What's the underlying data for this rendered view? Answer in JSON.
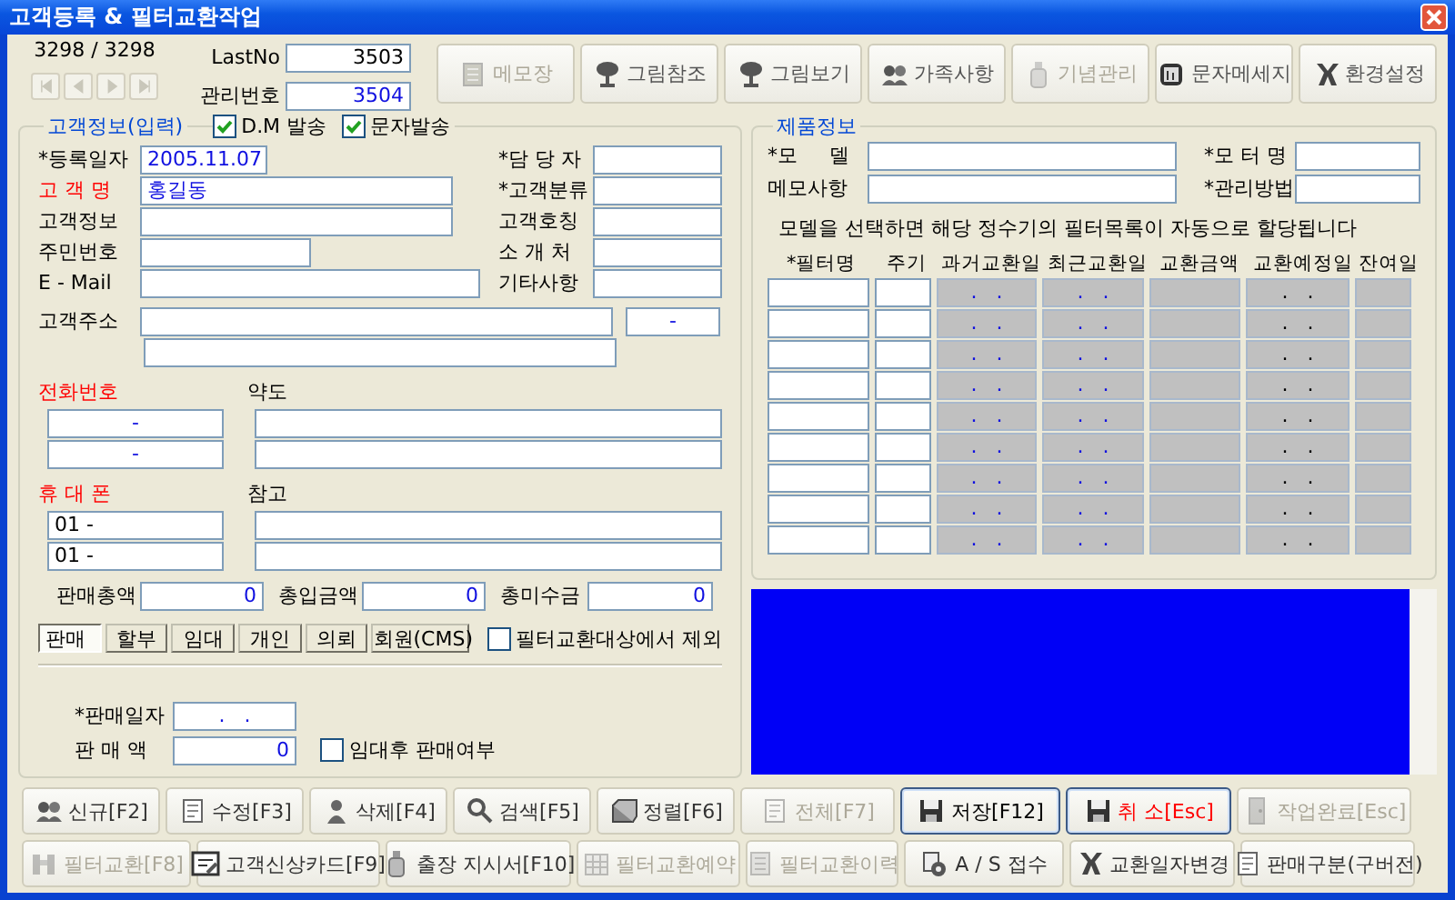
{
  "window": {
    "title": "고객등록 & 필터교환작업"
  },
  "record_nav": {
    "counter": "3298 / 3298",
    "buttons": [
      {
        "kind": "first",
        "disabled": true
      },
      {
        "kind": "prev",
        "disabled": true
      },
      {
        "kind": "next",
        "disabled": true
      },
      {
        "kind": "last",
        "disabled": true
      }
    ]
  },
  "last_no": {
    "label": "LastNo",
    "value": "3503"
  },
  "manage_no": {
    "label": "관리번호",
    "value": "3504"
  },
  "toolbar": [
    {
      "label": "메모장",
      "disabled": true
    },
    {
      "label": "그림참조",
      "disabled": false
    },
    {
      "label": "그림보기",
      "disabled": false
    },
    {
      "label": "가족사항",
      "disabled": false
    },
    {
      "label": "기념관리",
      "disabled": true
    },
    {
      "label": "문자메세지",
      "disabled": false
    },
    {
      "label": "환경설정",
      "disabled": false
    }
  ],
  "customer": {
    "title": "고객정보(입력)",
    "options": [
      {
        "label": "D.M 발송",
        "checked": true
      },
      {
        "label": "문자발송",
        "checked": true
      }
    ],
    "rows": [
      {
        "left": {
          "label": "*등록일자",
          "emphasis": false,
          "value": "2005.11.07"
        },
        "right": {
          "label": "*담 당 자",
          "emphasis": false
        }
      },
      {
        "left": {
          "label": "고 객 명",
          "emphasis": true,
          "value": "홍길동"
        },
        "right": {
          "label": "*고객분류",
          "emphasis": false
        }
      },
      {
        "left": {
          "label": "고객정보",
          "emphasis": false
        },
        "right": {
          "label": "고객호칭",
          "emphasis": false
        }
      },
      {
        "left": {
          "label": "주민번호",
          "emphasis": false
        },
        "right": {
          "label": "소 개 처",
          "emphasis": false
        }
      },
      {
        "left": {
          "label": "E - Mail",
          "emphasis": false
        },
        "right": {
          "label": "기타사항",
          "emphasis": false
        }
      }
    ],
    "address": {
      "label": "고객주소",
      "zip": "-"
    },
    "phones": {
      "label": "전화번호",
      "emphasis": true,
      "values": [
        "-",
        "-"
      ]
    },
    "directions": {
      "label": "약도"
    },
    "mobiles": {
      "label": "휴 대 폰",
      "emphasis": true,
      "values": [
        "01 -",
        "01 -"
      ]
    },
    "notes": {
      "label": "참고"
    },
    "totals": [
      {
        "label": "판매총액",
        "value": "0"
      },
      {
        "label": "총입금액",
        "value": "0"
      },
      {
        "label": "총미수금",
        "value": "0"
      }
    ],
    "sale_tabs": [
      {
        "label": "판매",
        "selected": true
      },
      {
        "label": "할부",
        "selected": false
      },
      {
        "label": "임대",
        "selected": false
      },
      {
        "label": "개인",
        "selected": false
      },
      {
        "label": "의뢰",
        "selected": false
      },
      {
        "label": "회원(CMS)",
        "selected": false
      }
    ],
    "exclude_filter": {
      "label": "필터교환대상에서 제외",
      "checked": false
    },
    "sale": {
      "date_label": "*판매일자",
      "date_value": ".   .",
      "amount_label": "판 매 액",
      "amount_value": "0",
      "after_lease": {
        "label": "임대후 판매여부",
        "checked": false
      }
    }
  },
  "product": {
    "title": "제품정보",
    "rows": [
      {
        "left": {
          "label": "*모     델"
        },
        "right": {
          "label": "*모 터 명"
        }
      },
      {
        "left": {
          "label": "메모사항"
        },
        "right": {
          "label": "*관리방법"
        }
      }
    ],
    "hint": "모델을 선택하면 해당 정수기의 필터목록이 자동으로 할당됩니다",
    "filter_table": {
      "columns": [
        "*필터명",
        "주기",
        "과거교환일",
        "최근교환일",
        "교환금액",
        "교환예정일",
        "잔여일"
      ],
      "rows": [
        {
          "past": ".   .",
          "recent": ".   .",
          "planned": ".   ."
        },
        {
          "past": ".   .",
          "recent": ".   .",
          "planned": ".   ."
        },
        {
          "past": ".   .",
          "recent": ".   .",
          "planned": ".   ."
        },
        {
          "past": ".   .",
          "recent": ".   .",
          "planned": ".   ."
        },
        {
          "past": ".   .",
          "recent": ".   .",
          "planned": ".   ."
        },
        {
          "past": ".   .",
          "recent": ".   .",
          "planned": ".   ."
        },
        {
          "past": ".   .",
          "recent": ".   .",
          "planned": ".   ."
        },
        {
          "past": ".   .",
          "recent": ".   .",
          "planned": ".   ."
        },
        {
          "past": ".   .",
          "recent": ".   .",
          "planned": ".   ."
        }
      ]
    }
  },
  "buttons": [
    [
      {
        "label": "신규[F2]",
        "disabled": false,
        "focused": false,
        "danger": false
      },
      {
        "label": "수정[F3]",
        "disabled": false,
        "focused": false,
        "danger": false
      },
      {
        "label": "삭제[F4]",
        "disabled": false,
        "focused": false,
        "danger": false
      },
      {
        "label": "검색[F5]",
        "disabled": false,
        "focused": false,
        "danger": false
      },
      {
        "label": "정렬[F6]",
        "disabled": false,
        "focused": false,
        "danger": false
      },
      {
        "label": "전체[F7]",
        "disabled": true,
        "focused": false,
        "danger": false
      },
      {
        "label": "저장[F12]",
        "disabled": false,
        "focused": true,
        "danger": false
      },
      {
        "label": "취 소[Esc]",
        "disabled": false,
        "focused": true,
        "danger": true
      },
      {
        "label": "작업완료[Esc]",
        "disabled": true,
        "focused": false,
        "danger": false
      }
    ],
    [
      {
        "label": "필터교환[F8]",
        "disabled": true,
        "focused": false,
        "danger": false
      },
      {
        "label": "고객신상카드[F9]",
        "disabled": false,
        "focused": false,
        "danger": false
      },
      {
        "label": "출장 지시서[F10]",
        "disabled": false,
        "focused": false,
        "danger": false
      },
      {
        "label": "필터교환예약",
        "disabled": true,
        "focused": false,
        "danger": false
      },
      {
        "label": "필터교환이력",
        "disabled": true,
        "focused": false,
        "danger": false
      },
      {
        "label": "A / S 접수",
        "disabled": false,
        "focused": false,
        "danger": false
      },
      {
        "label": "교환일자변경",
        "disabled": false,
        "focused": false,
        "danger": false
      },
      {
        "label": "판매구분(구버전)",
        "disabled": false,
        "focused": false,
        "danger": false
      }
    ]
  ]
}
